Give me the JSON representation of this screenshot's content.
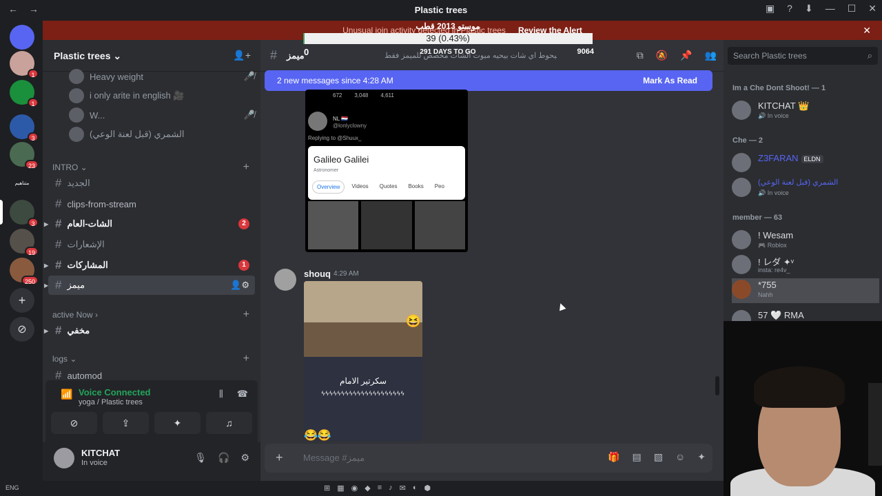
{
  "titlebar": {
    "title": "Plastic trees",
    "back": "←",
    "forward": "→",
    "controls": [
      "▣",
      "?",
      "⬇",
      "—",
      "☐",
      "✕"
    ]
  },
  "alert": {
    "text": "Unusual join activity detected in Plastic trees",
    "link": "Review the Alert",
    "close": "✕"
  },
  "progress": {
    "title": "موستو 2013 قطب",
    "bar_text": "39 (0.43%)",
    "fraction": 0.0043,
    "left_value": "0",
    "days": "291 DAYS TO GO",
    "right_value": "9064"
  },
  "servers": [
    {
      "label": "",
      "badge": ""
    },
    {
      "label": "",
      "badge": "1"
    },
    {
      "label": "",
      "badge": "1"
    },
    {
      "label": "",
      "badge": "3"
    },
    {
      "label": "",
      "badge": "23"
    },
    {
      "label": "متناهيم",
      "badge": ""
    },
    {
      "label": "",
      "badge": "3"
    },
    {
      "label": "",
      "badge": "19"
    },
    {
      "label": "",
      "badge": "250"
    },
    {
      "label": "+",
      "badge": ""
    },
    {
      "label": "⊘",
      "badge": ""
    }
  ],
  "sidebar": {
    "server_name": "Plastic trees ⌄",
    "voice_members": [
      {
        "name": "Heavy weight"
      },
      {
        "name": "i only arite in english 🎥"
      },
      {
        "name": "W..."
      },
      {
        "name": "الشمري (قبل لعنة الوعي)"
      }
    ],
    "categories": {
      "intro": "INTRO ⌄",
      "active": "active Now ›",
      "logs": "logs ⌄"
    },
    "channels": [
      {
        "name": "الجديد",
        "badge": ""
      },
      {
        "name": "clips-from-stream",
        "badge": ""
      },
      {
        "name": "الشات-العام",
        "badge": "2"
      },
      {
        "name": "الإشعارات",
        "badge": ""
      },
      {
        "name": "المشاركات",
        "badge": "1"
      },
      {
        "name": "ميمز",
        "badge": ""
      },
      {
        "name": "مخفي",
        "badge": ""
      },
      {
        "name": "automod",
        "badge": ""
      }
    ],
    "voice_status": "Voice Connected",
    "voice_location": "yoga / Plastic trees",
    "user": {
      "name": "KITCHAT",
      "status": "In voice"
    }
  },
  "chat": {
    "channel": "ميمز",
    "topic": "أي شخص بيكتب كلام او بيحوط اي شات بيحيه ميوت الشات مخصص للميمز فقط ..",
    "new_messages": "2 new messages since 4:28 AM",
    "mark_read": "Mark As Read",
    "embed": {
      "likes": [
        "672",
        "3,048",
        "4,611"
      ],
      "name": "NL 🇳🇱",
      "handle": "@lonlyclowny",
      "reply": "Replying to @Shuux_",
      "card_title": "Galileo Galilei",
      "card_subtitle": "Astronomer",
      "tabs": [
        "Overview",
        "Videos",
        "Quotes",
        "Books",
        "Peo"
      ]
    },
    "message": {
      "author": "shouq",
      "time": "4:29 AM",
      "caption": "سكرتير الامام",
      "decoration": "ϟϟϟϟϟϟϟϟϟϟϟϟϟϟϟϟϟϟϟϟϟ"
    },
    "composer_placeholder": "Message #ميمز"
  },
  "members": {
    "search_placeholder": "Search Plastic trees",
    "sections": [
      {
        "title": "Im a Che Dont Shoot! — 1"
      },
      {
        "title": "Che — 2"
      },
      {
        "title": "member — 63"
      }
    ],
    "list": [
      {
        "name": "KITCHAT 👑",
        "sub": "🔊 In voice",
        "color": "#dbdee1",
        "tag": ""
      },
      {
        "name": "Z3FARAN",
        "sub": "",
        "color": "#5865f2",
        "tag": "ELDN"
      },
      {
        "name": "الشمري (قبل لعنة الوعي)",
        "sub": "🔊 In voice",
        "color": "#5865f2",
        "tag": ""
      },
      {
        "name": "! Wesam",
        "sub": "🎮 Roblox",
        "color": "#dbdee1",
        "tag": ""
      },
      {
        "name": "! レダ ✦ᵛ",
        "sub": "insta: re4v_",
        "color": "#dbdee1",
        "tag": ""
      },
      {
        "name": "*755",
        "sub": "Nahh",
        "color": "#dbdee1",
        "tag": ""
      },
      {
        "name": "57 🤍 RMA",
        "sub": "",
        "color": "#dbdee1",
        "tag": ""
      }
    ]
  },
  "taskbar": {
    "left": "ENG",
    "icons": [
      "⊞",
      "▦",
      "◉",
      "◆",
      "≡",
      "♪",
      "✉",
      "◐",
      "⬢"
    ]
  }
}
